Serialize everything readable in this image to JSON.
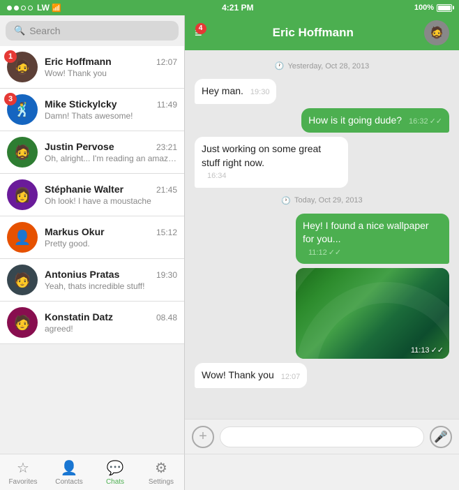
{
  "statusBar": {
    "carrier": "LW",
    "time": "4:21 PM",
    "battery": "100%"
  },
  "search": {
    "placeholder": "Search"
  },
  "chatList": [
    {
      "id": 1,
      "name": "Eric Hoffmann",
      "time": "12:07",
      "preview": "Wow! Thank you",
      "badge": 1,
      "avatarEmoji": "🧔"
    },
    {
      "id": 2,
      "name": "Mike Stickylcky",
      "time": "11:49",
      "preview": "Damn! Thats awesome!",
      "badge": 3,
      "avatarEmoji": "🕺"
    },
    {
      "id": 3,
      "name": "Justin Pervose",
      "time": "23:21",
      "preview": "Oh, alright... I'm reading an amazing article at...",
      "badge": 0,
      "avatarEmoji": "🧔"
    },
    {
      "id": 4,
      "name": "Stéphanie Walter",
      "time": "21:45",
      "preview": "Oh look! I have a moustache",
      "badge": 0,
      "avatarEmoji": "👩"
    },
    {
      "id": 5,
      "name": "Markus Okur",
      "time": "15:12",
      "preview": "Pretty good.",
      "badge": 0,
      "avatarEmoji": "👤"
    },
    {
      "id": 6,
      "name": "Antonius Pratas",
      "time": "19:30",
      "preview": "Yeah, thats incredible stuff!",
      "badge": 0,
      "avatarEmoji": "🧑"
    },
    {
      "id": 7,
      "name": "Konstatin Datz",
      "time": "08.48",
      "preview": "agreed!",
      "badge": 0,
      "avatarEmoji": "🧑"
    }
  ],
  "chatHeader": {
    "name": "Eric Hoffmann",
    "menuBadge": 4,
    "avatarEmoji": "🧔"
  },
  "messages": [
    {
      "type": "date",
      "text": "Yesterday, Oct 28, 2013"
    },
    {
      "type": "incoming",
      "text": "Hey man.",
      "time": "19:30"
    },
    {
      "type": "outgoing",
      "text": "How is it going dude?",
      "time": "16:32",
      "ticks": "✓✓"
    },
    {
      "type": "incoming",
      "text": "Just working on some great stuff right now.",
      "time": "16:34"
    },
    {
      "type": "date",
      "text": "Today, Oct 29, 2013"
    },
    {
      "type": "outgoing",
      "text": "Hey! I found a nice wallpaper for you...",
      "time": "11:12",
      "ticks": "✓✓"
    },
    {
      "type": "image-outgoing",
      "time": "11:13",
      "ticks": "✓✓"
    },
    {
      "type": "incoming",
      "text": "Wow! Thank you",
      "time": "12:07"
    }
  ],
  "inputBar": {
    "placeholder": ""
  },
  "tabs": [
    {
      "id": "favorites",
      "label": "Favorites",
      "icon": "☆",
      "active": false
    },
    {
      "id": "contacts",
      "label": "Contacts",
      "icon": "👤",
      "active": false
    },
    {
      "id": "chats",
      "label": "Chats",
      "icon": "💬",
      "active": true
    },
    {
      "id": "settings",
      "label": "Settings",
      "icon": "⚙",
      "active": false
    }
  ]
}
